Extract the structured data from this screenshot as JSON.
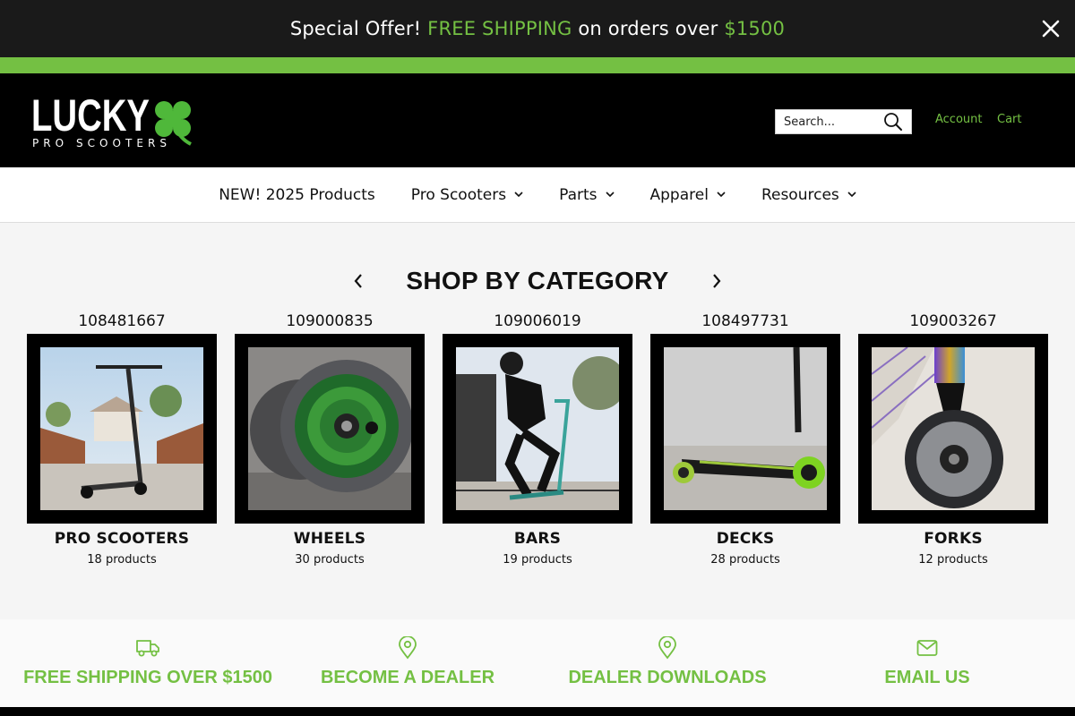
{
  "announcement": {
    "prefix": "Special Offer! ",
    "highlight1": "FREE SHIPPING",
    "middle": " on orders over ",
    "highlight2": "$1500",
    "close_icon": "close-icon"
  },
  "header": {
    "logo_word": "LUCKY",
    "logo_sub": "PRO SCOOTERS",
    "search_placeholder": "Search...",
    "account_label": "Account",
    "cart_label": "Cart"
  },
  "nav": {
    "items": [
      {
        "label": "NEW! 2025 Products",
        "has_dropdown": false
      },
      {
        "label": "Pro Scooters",
        "has_dropdown": true
      },
      {
        "label": "Parts",
        "has_dropdown": true
      },
      {
        "label": "Apparel",
        "has_dropdown": true
      },
      {
        "label": "Resources",
        "has_dropdown": true
      }
    ]
  },
  "category_section": {
    "title": "SHOP BY CATEGORY",
    "cards": [
      {
        "id": "108481667",
        "name": "PRO SCOOTERS",
        "count": "18 products"
      },
      {
        "id": "109000835",
        "name": "WHEELS",
        "count": "30 products"
      },
      {
        "id": "109006019",
        "name": "BARS",
        "count": "19 products"
      },
      {
        "id": "108497731",
        "name": "DECKS",
        "count": "28 products"
      },
      {
        "id": "109003267",
        "name": "FORKS",
        "count": "12 products"
      }
    ]
  },
  "features": {
    "items": [
      {
        "label": "FREE SHIPPING OVER $1500",
        "icon": "truck-icon"
      },
      {
        "label": "BECOME A DEALER",
        "icon": "map-pin-icon"
      },
      {
        "label": "DEALER DOWNLOADS",
        "icon": "map-pin-icon"
      },
      {
        "label": "EMAIL US",
        "icon": "envelope-icon"
      }
    ]
  },
  "colors": {
    "accent": "#74c043",
    "announcement_bg": "#1a1a1a",
    "header_bg": "#000000"
  }
}
